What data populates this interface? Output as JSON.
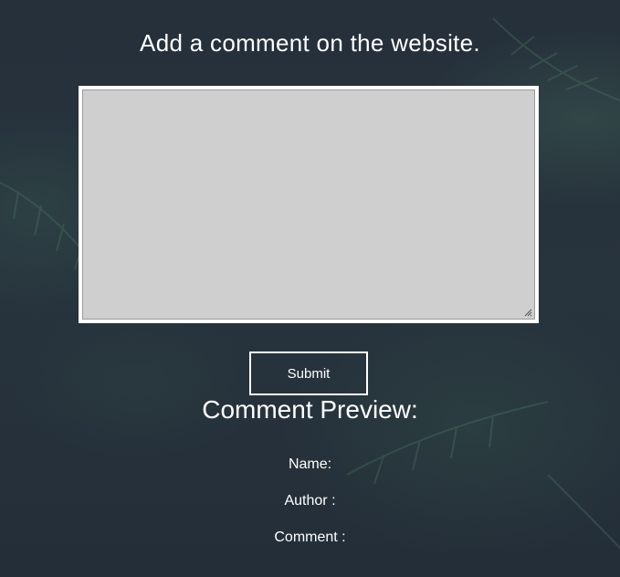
{
  "form": {
    "heading": "Add a comment on the website.",
    "comment_value": "",
    "submit_label": "Submit"
  },
  "preview": {
    "heading": "Comment Preview:",
    "name_label": "Name:",
    "author_label": "Author :",
    "comment_label": "Comment :"
  },
  "icons": {
    "resize_grip": "resize-grip-icon"
  },
  "colors": {
    "background": "#26313d",
    "text": "#ffffff",
    "textarea_fill": "#cfcfcf",
    "border": "#ffffff"
  }
}
